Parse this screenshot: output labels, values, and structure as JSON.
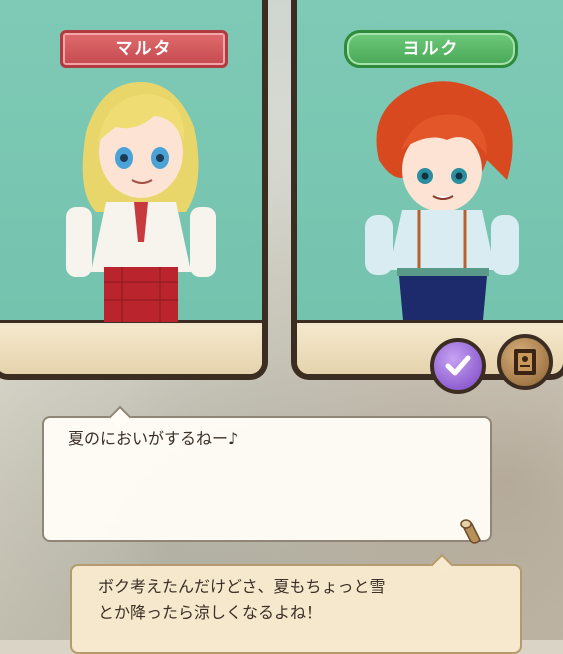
{
  "left_character": {
    "name": "マルタ",
    "plate_color": "#d95a5e"
  },
  "right_character": {
    "name": "ヨルク",
    "plate_color": "#52b25f"
  },
  "buttons": {
    "check": "check-icon",
    "journal": "journal-icon"
  },
  "dialog": {
    "line1": "夏のにおいがするねー♪",
    "line2_a": "ボク考えたんだけどさ、夏もちょっと雪",
    "line2_b": "とか降ったら涼しくなるよね！"
  }
}
